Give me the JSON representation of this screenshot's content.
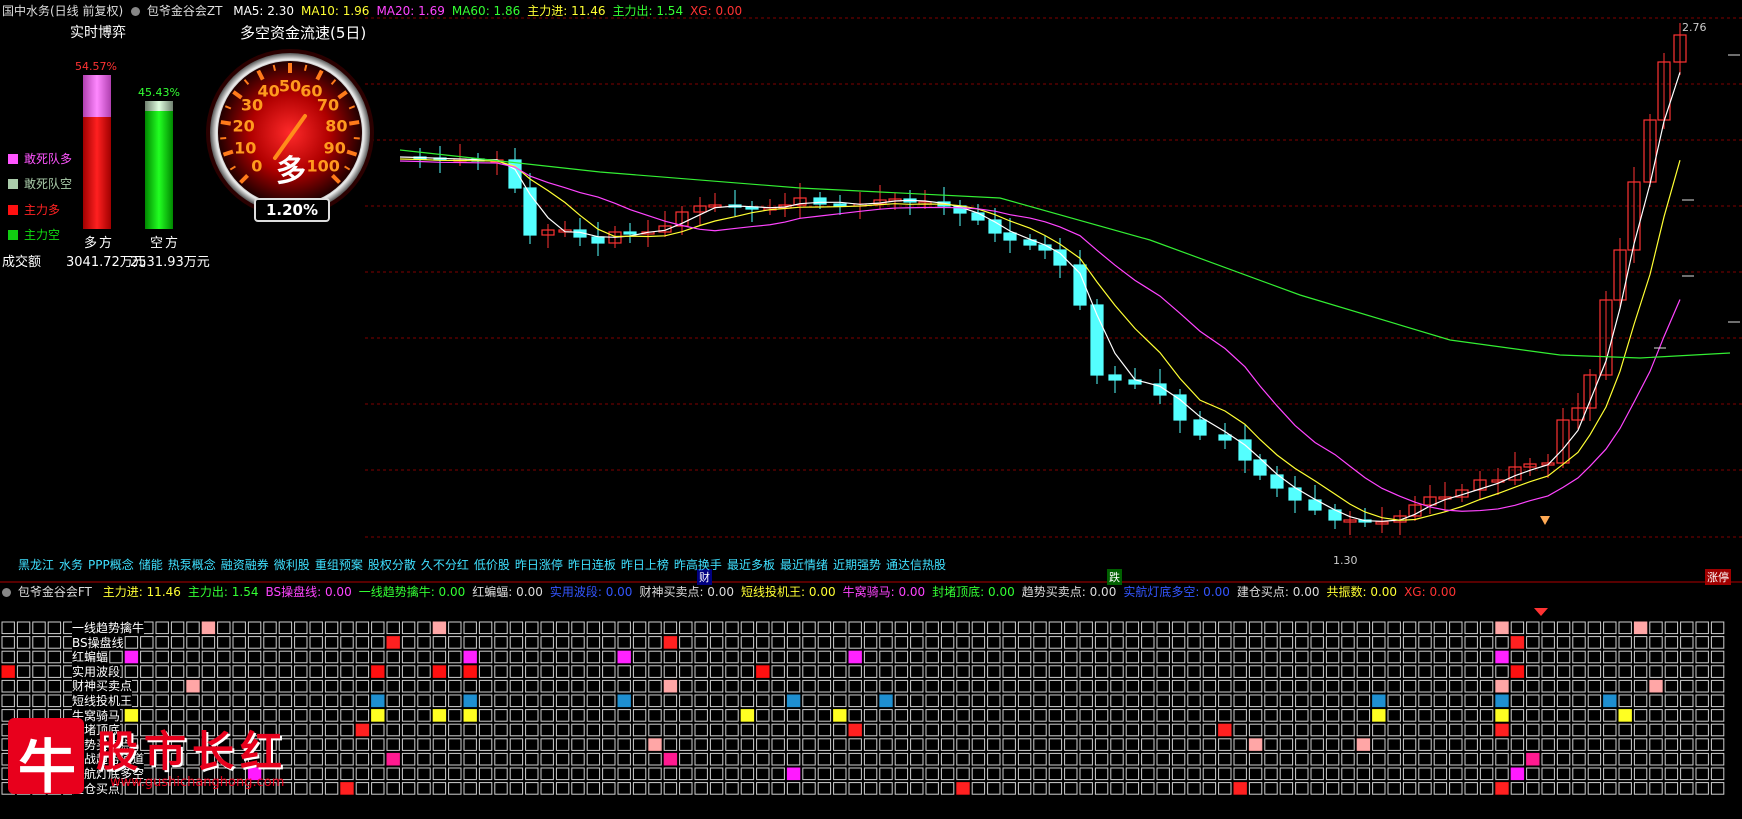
{
  "top_bar": {
    "stock": "国中水务(日线 前复权)",
    "indicator": "包爷金谷会ZT",
    "values": [
      {
        "text": "MA5: 2.30",
        "color": "#ffffff"
      },
      {
        "text": "MA10: 1.96",
        "color": "#ffff33"
      },
      {
        "text": "MA20: 1.69",
        "color": "#ff44ff"
      },
      {
        "text": "MA60: 1.86",
        "color": "#33ff33"
      },
      {
        "text": "主力进: 11.46",
        "color": "#ffff33"
      },
      {
        "text": "主力出: 1.54",
        "color": "#33ff33"
      },
      {
        "text": "XG: 0.00",
        "color": "#ff3333"
      }
    ]
  },
  "left_panel": {
    "title": "实时博弈",
    "duo_pct": "54.57%",
    "kong_pct": "45.43%",
    "duo_pct_value": 54.57,
    "kong_pct_value": 45.43,
    "legend": [
      {
        "label": "敢死队多",
        "color": "#ff55ff"
      },
      {
        "label": "敢死队空",
        "color": "#aaccaa"
      },
      {
        "label": "主力多",
        "color": "#ff1111"
      },
      {
        "label": "主力空",
        "color": "#11cc11"
      }
    ],
    "duo_label": "多方",
    "kong_label": "空方",
    "volume_label": "成交额",
    "duo_amount": "3041.72万元",
    "kong_amount": "2531.93万元"
  },
  "gauge": {
    "title": "多空资金流速(5日)",
    "center_char": "多",
    "value_text": "1.20%",
    "value": 1.2,
    "ticks": [
      "0",
      "10",
      "20",
      "30",
      "40",
      "50",
      "60",
      "70",
      "80",
      "90",
      "100"
    ]
  },
  "price_labels": {
    "high": "2.76",
    "low": "1.30"
  },
  "ticker_tags": [
    "黑龙江",
    "水务",
    "PPP概念",
    "储能",
    "热泵概念",
    "融资融券",
    "微利股",
    "重组预案",
    "股权分散",
    "久不分红",
    "低价股",
    "昨日涨停",
    "昨日连板",
    "昨日上榜",
    "昨高换手",
    "最近多板",
    "最近情绪",
    "近期强势",
    "通达信热股"
  ],
  "chart_tags": {
    "cai": "财",
    "die": "跌",
    "zhang": "涨停"
  },
  "lower_bar": {
    "indicator": "包爷金谷会FT",
    "values": [
      {
        "text": "主力进: 11.46",
        "color": "#ffff33"
      },
      {
        "text": "主力出: 1.54",
        "color": "#33ff33"
      },
      {
        "text": "BS操盘线: 0.00",
        "color": "#ff44ff"
      },
      {
        "text": "一线趋势擒牛: 0.00",
        "color": "#33ff33"
      },
      {
        "text": "红蝙蝠: 0.00",
        "color": "#dddddd"
      },
      {
        "text": "实用波段: 0.00",
        "color": "#3355ff"
      },
      {
        "text": "财神买卖点: 0.00",
        "color": "#dddddd"
      },
      {
        "text": "短线投机王: 0.00",
        "color": "#ffff33"
      },
      {
        "text": "牛窝骑马: 0.00",
        "color": "#ff44ff"
      },
      {
        "text": "封堵顶底: 0.00",
        "color": "#33ff33"
      },
      {
        "text": "趋势买卖点: 0.00",
        "color": "#dddddd"
      },
      {
        "text": "实航灯底多空: 0.00",
        "color": "#3355ff"
      },
      {
        "text": "建仓买点: 0.00",
        "color": "#dddddd"
      },
      {
        "text": "共振数: 0.00",
        "color": "#ffff33"
      },
      {
        "text": "XG: 0.00",
        "color": "#ff3333"
      }
    ]
  },
  "signal_rows": [
    "一线趋势擒牛",
    "BS操盘线",
    "红蝙蝠",
    "实用波段",
    "财神买卖点",
    "短线投机王",
    "牛窝骑马",
    "封堵顶底",
    "趋势买卖点",
    "实战趋势通道",
    "实航灯底多空",
    "建仓买点"
  ],
  "watermark": {
    "text": "股市长红",
    "url": "www.gushichanghong.com",
    "logo_char": "牛"
  },
  "colors": {
    "up": "#ff3333",
    "down": "#54ffff",
    "ma5": "#ffffff",
    "ma10": "#ffff33",
    "ma20": "#ff44ff",
    "ma60": "#33ee33",
    "grid": "#800000"
  }
}
